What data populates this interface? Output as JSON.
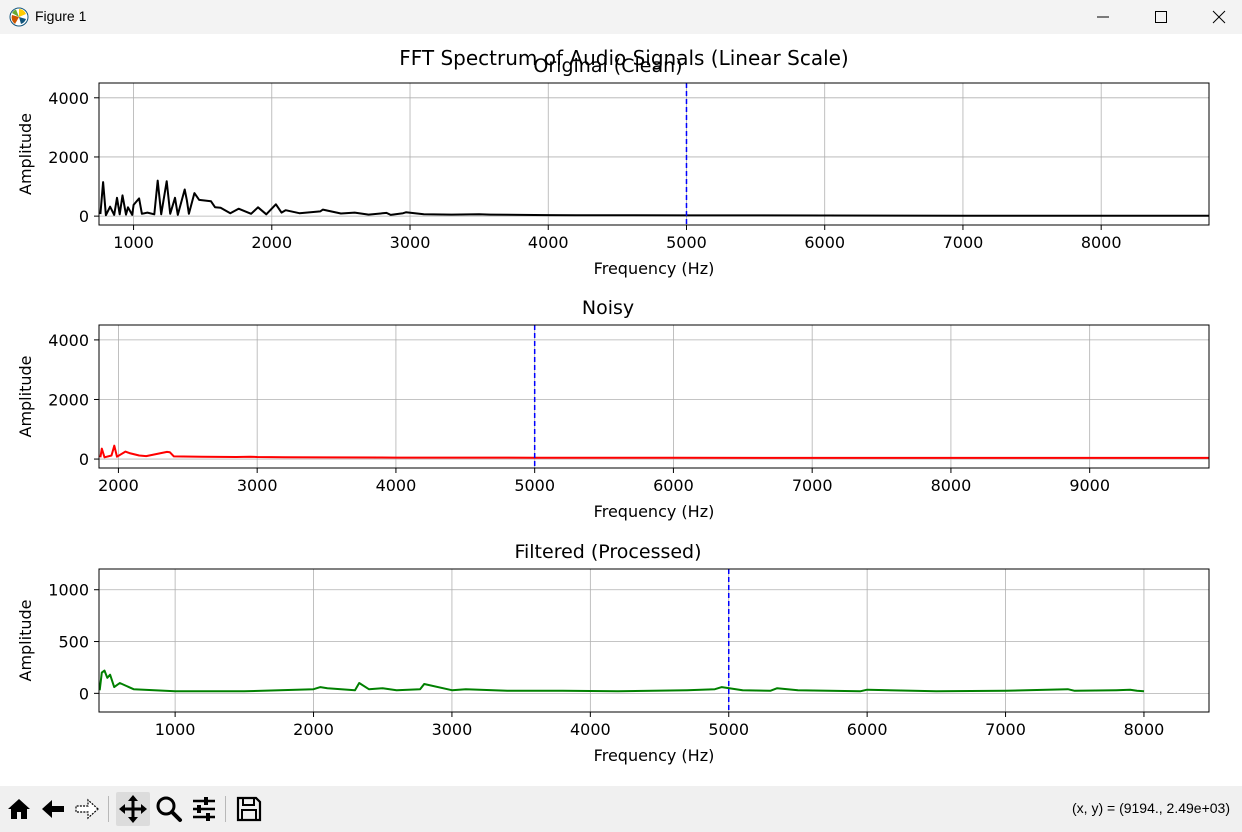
{
  "window": {
    "title": "Figure 1",
    "icon": "matplotlib-logo-icon",
    "controls": [
      "minimize-icon",
      "maximize-icon",
      "close-icon"
    ]
  },
  "figure": {
    "suptitle": "FFT Spectrum of Audio Signals (Linear Scale)"
  },
  "chart_data": [
    {
      "type": "line",
      "title": "Original (Clean)",
      "xlabel": "Frequency (Hz)",
      "ylabel": "Amplitude",
      "xlim": [
        750,
        8780
      ],
      "ylim": [
        -300,
        4500
      ],
      "xticks": [
        1000,
        2000,
        3000,
        4000,
        5000,
        6000,
        7000,
        8000
      ],
      "yticks": [
        0,
        2000,
        4000
      ],
      "grid": true,
      "color": "#000000",
      "cutoff_line": {
        "x": 5000,
        "color": "#0000ff",
        "style": "dashed"
      },
      "series": [
        {
          "x": [
            760,
            780,
            800,
            830,
            860,
            880,
            900,
            920,
            945,
            960,
            990,
            1000,
            1040,
            1060,
            1100,
            1150,
            1175,
            1200,
            1240,
            1265,
            1300,
            1320,
            1370,
            1385,
            1400,
            1440,
            1475,
            1560,
            1590,
            1630,
            1700,
            1760,
            1850,
            1900,
            1960,
            2030,
            2070,
            2100,
            2200,
            2350,
            2370,
            2500,
            2600,
            2700,
            2830,
            2860,
            2950,
            2970,
            3100,
            3300,
            3500,
            3580,
            3800,
            4000,
            4200,
            4500,
            5000,
            5400,
            6000,
            7000,
            8780
          ],
          "values": [
            70,
            1150,
            30,
            320,
            40,
            620,
            60,
            700,
            50,
            300,
            40,
            380,
            600,
            80,
            120,
            60,
            1200,
            60,
            1180,
            80,
            620,
            40,
            900,
            550,
            80,
            780,
            550,
            500,
            300,
            280,
            100,
            250,
            80,
            300,
            60,
            400,
            120,
            200,
            100,
            160,
            220,
            90,
            120,
            50,
            110,
            40,
            100,
            130,
            60,
            50,
            60,
            50,
            40,
            35,
            30,
            30,
            25,
            25,
            20,
            15,
            15
          ]
        }
      ]
    },
    {
      "type": "line",
      "title": "Noisy",
      "xlabel": "Frequency (Hz)",
      "ylabel": "Amplitude",
      "xlim": [
        1860,
        9860
      ],
      "ylim": [
        -300,
        4500
      ],
      "xticks": [
        2000,
        3000,
        4000,
        5000,
        6000,
        7000,
        8000,
        9000
      ],
      "yticks": [
        0,
        2000,
        4000
      ],
      "grid": true,
      "color": "#ff0000",
      "cutoff_line": {
        "x": 5000,
        "color": "#0000ff",
        "style": "dashed"
      },
      "series": [
        {
          "x": [
            1870,
            1880,
            1900,
            1950,
            1970,
            1990,
            2050,
            2080,
            2150,
            2200,
            2350,
            2370,
            2400,
            2600,
            2850,
            2950,
            3000,
            3200,
            3500,
            4000,
            5000,
            6000,
            7000,
            8000,
            9000,
            9860
          ],
          "values": [
            60,
            350,
            60,
            120,
            450,
            80,
            250,
            200,
            120,
            100,
            240,
            230,
            90,
            80,
            70,
            80,
            70,
            60,
            55,
            50,
            45,
            45,
            40,
            40,
            40,
            40
          ]
        }
      ]
    },
    {
      "type": "line",
      "title": "Filtered (Processed)",
      "xlabel": "Frequency (Hz)",
      "ylabel": "Amplitude",
      "xlim": [
        450,
        8470
      ],
      "ylim": [
        -180,
        1200
      ],
      "xticks": [
        1000,
        2000,
        3000,
        4000,
        5000,
        6000,
        7000,
        8000
      ],
      "yticks": [
        0,
        500,
        1000
      ],
      "grid": true,
      "color": "#008000",
      "cutoff_line": {
        "x": 5000,
        "color": "#0000ff",
        "style": "dashed"
      },
      "series": [
        {
          "x": [
            455,
            470,
            490,
            510,
            530,
            560,
            600,
            700,
            850,
            1000,
            1500,
            2000,
            2050,
            2100,
            2300,
            2330,
            2400,
            2500,
            2600,
            2770,
            2800,
            3000,
            3100,
            3400,
            3800,
            4200,
            4700,
            4900,
            4950,
            5100,
            5300,
            5350,
            5500,
            5950,
            6000,
            6500,
            7000,
            7450,
            7500,
            7800,
            7900,
            7950,
            8000
          ],
          "values": [
            30,
            200,
            220,
            150,
            180,
            60,
            100,
            40,
            30,
            20,
            20,
            40,
            60,
            50,
            30,
            100,
            40,
            50,
            30,
            40,
            90,
            30,
            40,
            25,
            25,
            20,
            30,
            40,
            60,
            30,
            25,
            50,
            30,
            20,
            35,
            20,
            25,
            40,
            25,
            30,
            35,
            25,
            20
          ]
        }
      ]
    }
  ],
  "toolbar": {
    "buttons": [
      {
        "name": "home-icon",
        "tooltip": "Home"
      },
      {
        "name": "back-icon",
        "tooltip": "Back"
      },
      {
        "name": "forward-icon",
        "tooltip": "Forward"
      },
      {
        "name": "pan-icon",
        "tooltip": "Pan",
        "active": true
      },
      {
        "name": "zoom-icon",
        "tooltip": "Zoom"
      },
      {
        "name": "configure-subplots-icon",
        "tooltip": "Subplots"
      },
      {
        "name": "save-icon",
        "tooltip": "Save"
      }
    ],
    "coords": "(x, y) = (9194., 2.49e+03)"
  }
}
